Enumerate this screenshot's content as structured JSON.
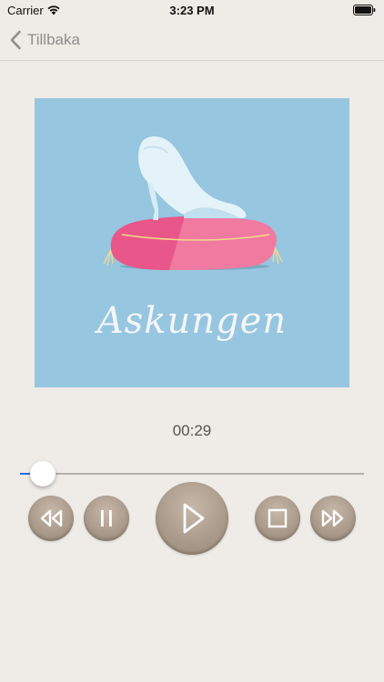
{
  "status_bar": {
    "carrier": "Carrier",
    "time": "3:23 PM"
  },
  "nav": {
    "back_label": "Tillbaka"
  },
  "cover": {
    "title": "Askungen",
    "background_color": "#97c6e0"
  },
  "player": {
    "elapsed": "00:29",
    "progress_fraction": 0.065,
    "accent_color": "#1e6fe0",
    "controls": {
      "rewind": "rewind-icon",
      "pause": "pause-icon",
      "play": "play-icon",
      "stop": "stop-icon",
      "fast_forward": "fast-forward-icon"
    }
  }
}
